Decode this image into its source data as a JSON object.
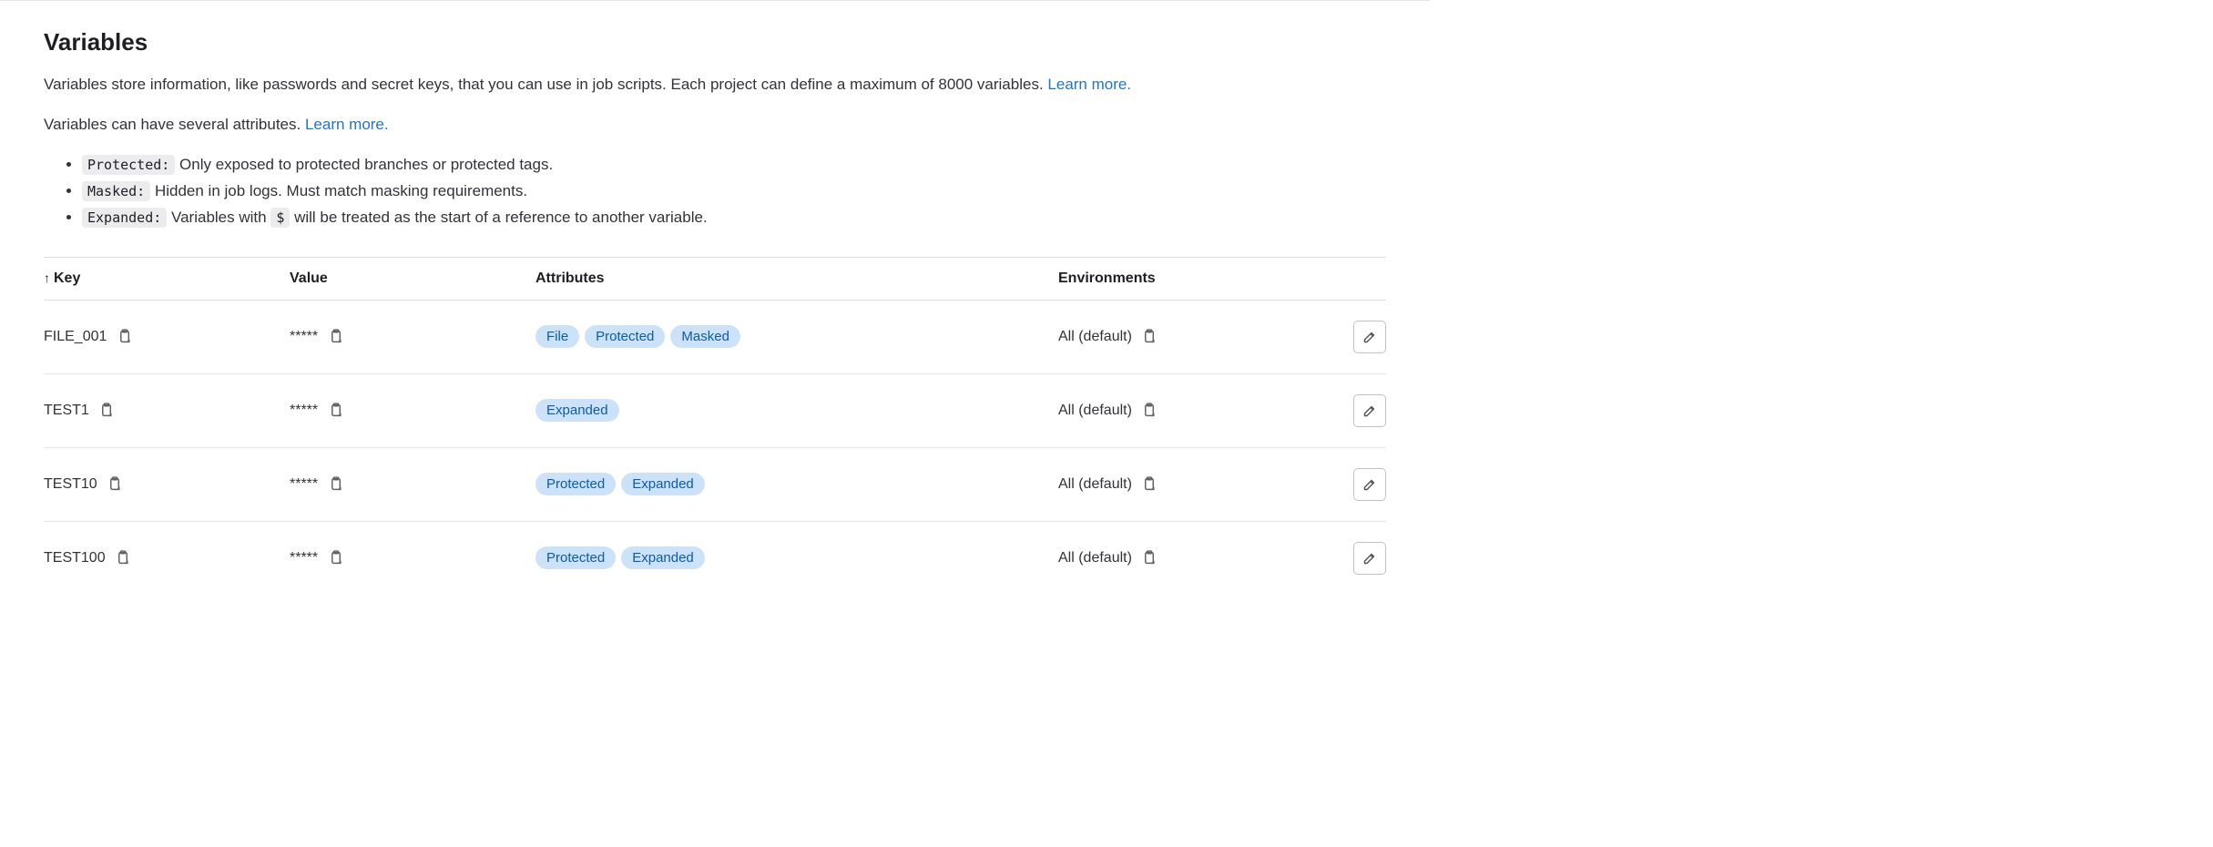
{
  "header": {
    "title": "Variables",
    "desc1_pre": "Variables store information, like passwords and secret keys, that you can use in job scripts. Each project can define a maximum of 8000 variables. ",
    "desc1_link": "Learn more.",
    "desc2_pre": "Variables can have several attributes. ",
    "desc2_link": "Learn more."
  },
  "attr_definitions": [
    {
      "code": "Protected:",
      "text": "Only exposed to protected branches or protected tags."
    },
    {
      "code": "Masked:",
      "text": "Hidden in job logs. Must match masking requirements."
    },
    {
      "code": "Expanded:",
      "dollar": "$",
      "text_pre": "Variables with ",
      "text_post": " will be treated as the start of a reference to another variable."
    }
  ],
  "table": {
    "sort_label": "↑",
    "columns": {
      "key": "Key",
      "value": "Value",
      "attrs": "Attributes",
      "env": "Environments"
    },
    "rows": [
      {
        "key": "FILE_001",
        "value": "*****",
        "attrs": [
          "File",
          "Protected",
          "Masked"
        ],
        "env": "All (default)"
      },
      {
        "key": "TEST1",
        "value": "*****",
        "attrs": [
          "Expanded"
        ],
        "env": "All (default)"
      },
      {
        "key": "TEST10",
        "value": "*****",
        "attrs": [
          "Protected",
          "Expanded"
        ],
        "env": "All (default)"
      },
      {
        "key": "TEST100",
        "value": "*****",
        "attrs": [
          "Protected",
          "Expanded"
        ],
        "env": "All (default)"
      }
    ]
  }
}
